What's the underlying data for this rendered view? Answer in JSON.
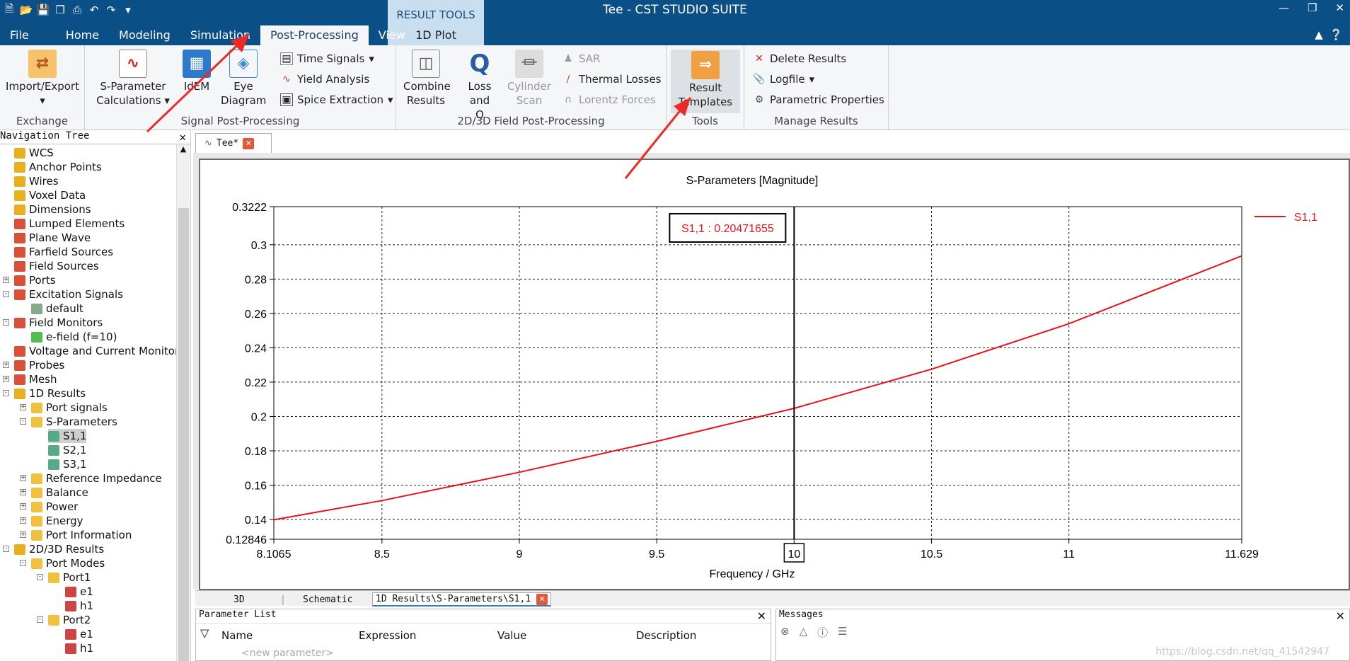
{
  "window": {
    "title": "Tee - CST STUDIO SUITE"
  },
  "context_tab": {
    "group": "RESULT TOOLS",
    "tab": "1D Plot"
  },
  "menu_tabs": [
    "File",
    "Home",
    "Modeling",
    "Simulation",
    "Post-Processing",
    "View"
  ],
  "active_tab": "Post-Processing",
  "ribbon": {
    "exchange": {
      "label": "Exchange",
      "import_export": "Import/Export"
    },
    "signal": {
      "label": "Signal Post-Processing",
      "sparam": "S-Parameter",
      "sparam2": "Calculations",
      "idem": "IdEM",
      "eye": "Eye",
      "eye2": "Diagram",
      "time_signals": "Time Signals",
      "yield": "Yield Analysis",
      "spice": "Spice Extraction"
    },
    "field": {
      "label": "2D/3D Field Post-Processing",
      "combine": "Combine",
      "combine2": "Results",
      "lossq": "Loss and",
      "lossq2": "Q",
      "cyl": "Cylinder",
      "cyl2": "Scan",
      "sar": "SAR",
      "thermal": "Thermal Losses",
      "lorentz": "Lorentz Forces"
    },
    "tools": {
      "label": "Tools",
      "result": "Result",
      "result2": "Templates"
    },
    "manage": {
      "label": "Manage Results",
      "delete": "Delete Results",
      "logfile": "Logfile",
      "param": "Parametric Properties"
    }
  },
  "nav": {
    "title": "Navigation Tree",
    "items": [
      "WCS",
      "Anchor Points",
      "Wires",
      "Voxel Data",
      "Dimensions",
      "Lumped Elements",
      "Plane Wave",
      "Farfield Sources",
      "Field Sources",
      "Ports",
      "Excitation Signals",
      "default",
      "Field Monitors",
      "e-field (f=10)",
      "Voltage and Current Monitors",
      "Probes",
      "Mesh",
      "1D Results",
      "Port signals",
      "S-Parameters",
      "S1,1",
      "S2,1",
      "S3,1",
      "Reference Impedance",
      "Balance",
      "Power",
      "Energy",
      "Port Information",
      "2D/3D Results",
      "Port Modes",
      "Port1",
      "e1",
      "h1",
      "Port2",
      "e1",
      "h1"
    ]
  },
  "doc_tab": "Tee*",
  "bottom_tabs": [
    "3D",
    "Schematic",
    "1D Results\\S-Parameters\\S1,1"
  ],
  "param_list": {
    "title": "Parameter List",
    "columns": [
      "Name",
      "Expression",
      "Value",
      "Description"
    ],
    "new_param": "<new parameter>"
  },
  "messages": {
    "title": "Messages"
  },
  "watermark": "https://blog.csdn.net/qq_41542947",
  "chart_data": {
    "type": "line",
    "title": "S-Parameters [Magnitude]",
    "xlabel": "Frequency / GHz",
    "ylabel": "",
    "xlim": [
      8.1065,
      11.629
    ],
    "ylim": [
      0.12846,
      0.3222
    ],
    "xticks": [
      "8.1065",
      "8.5",
      "9",
      "9.5",
      "10",
      "10.5",
      "11",
      "11.629"
    ],
    "yticks": [
      "0.3222",
      "0.3",
      "0.28",
      "0.26",
      "0.24",
      "0.22",
      "0.2",
      "0.18",
      "0.16",
      "0.14",
      "0.12846"
    ],
    "grid": true,
    "legend_position": "top-right",
    "series": [
      {
        "name": "S1,1",
        "color": "#e8141c",
        "x": [
          8.1065,
          8.5,
          9.0,
          9.5,
          10.0,
          10.5,
          11.0,
          11.629
        ],
        "y": [
          0.1398,
          0.151,
          0.1675,
          0.1855,
          0.2047,
          0.2275,
          0.254,
          0.2935
        ]
      }
    ],
    "marker": {
      "x": 10,
      "label": "S1,1 : 0.20471655"
    }
  }
}
